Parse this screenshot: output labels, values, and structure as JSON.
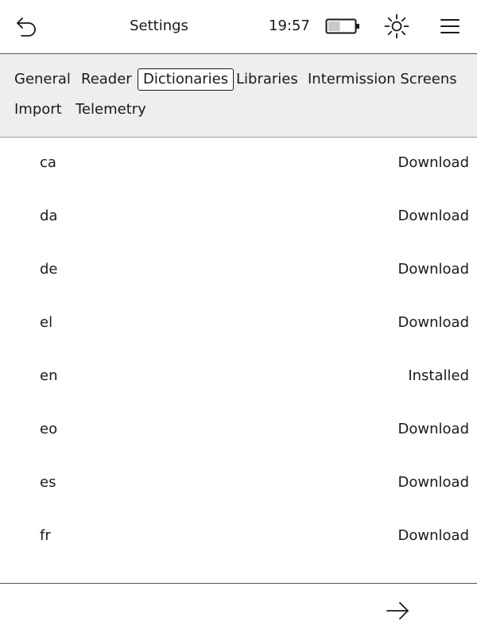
{
  "topbar": {
    "title": "Settings",
    "time": "19:57",
    "back_icon": "back-arrow-icon",
    "battery_icon": "battery-icon",
    "battery_level": 0.45,
    "frontlight_icon": "sun-icon",
    "menu_icon": "hamburger-menu-icon"
  },
  "tabs": [
    {
      "label": "General"
    },
    {
      "label": "Reader"
    },
    {
      "label": "Dictionaries"
    },
    {
      "label": "Libraries"
    },
    {
      "label": "Intermission Screens"
    },
    {
      "label": "Import"
    },
    {
      "label": "Telemetry"
    }
  ],
  "selected_tab": "Dictionaries",
  "dictionaries": [
    {
      "lang": "ca",
      "status": "Download"
    },
    {
      "lang": "da",
      "status": "Download"
    },
    {
      "lang": "de",
      "status": "Download"
    },
    {
      "lang": "el",
      "status": "Download"
    },
    {
      "lang": "en",
      "status": "Installed"
    },
    {
      "lang": "eo",
      "status": "Download"
    },
    {
      "lang": "es",
      "status": "Download"
    },
    {
      "lang": "fr",
      "status": "Download"
    }
  ],
  "bottombar": {
    "next_icon": "right-arrow-icon"
  }
}
